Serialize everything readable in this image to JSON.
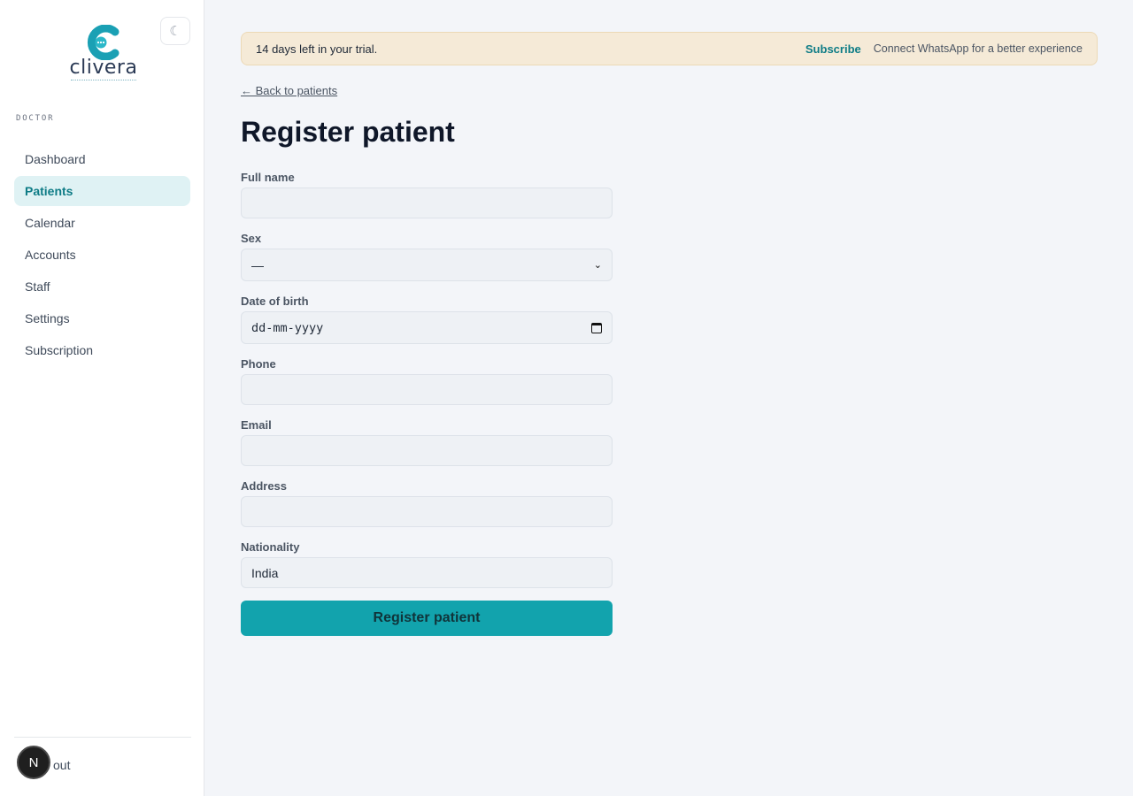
{
  "brand": {
    "name": "clivera",
    "accent": "#12a3ad"
  },
  "sidebar": {
    "theme_toggle_icon": "moon-icon",
    "role": "DOCTOR",
    "items": [
      {
        "label": "Dashboard",
        "active": false
      },
      {
        "label": "Patients",
        "active": true
      },
      {
        "label": "Calendar",
        "active": false
      },
      {
        "label": "Accounts",
        "active": false
      },
      {
        "label": "Staff",
        "active": false
      },
      {
        "label": "Settings",
        "active": false
      },
      {
        "label": "Subscription",
        "active": false
      }
    ],
    "logout_label": "out",
    "avatar_letter": "N"
  },
  "banner": {
    "trial_text": "14 days left in your trial.",
    "subscribe_label": "Subscribe",
    "connect_text": "Connect WhatsApp for a better experience"
  },
  "back_link": "← Back to patients",
  "page_title": "Register patient",
  "form": {
    "full_name": {
      "label": "Full name",
      "value": ""
    },
    "sex": {
      "label": "Sex",
      "value": "—"
    },
    "dob": {
      "label": "Date of birth",
      "value": "dd-mm-yyyy"
    },
    "phone": {
      "label": "Phone",
      "value": ""
    },
    "email": {
      "label": "Email",
      "value": ""
    },
    "address": {
      "label": "Address",
      "value": ""
    },
    "nationality": {
      "label": "Nationality",
      "value": "India"
    },
    "submit_label": "Register patient"
  }
}
